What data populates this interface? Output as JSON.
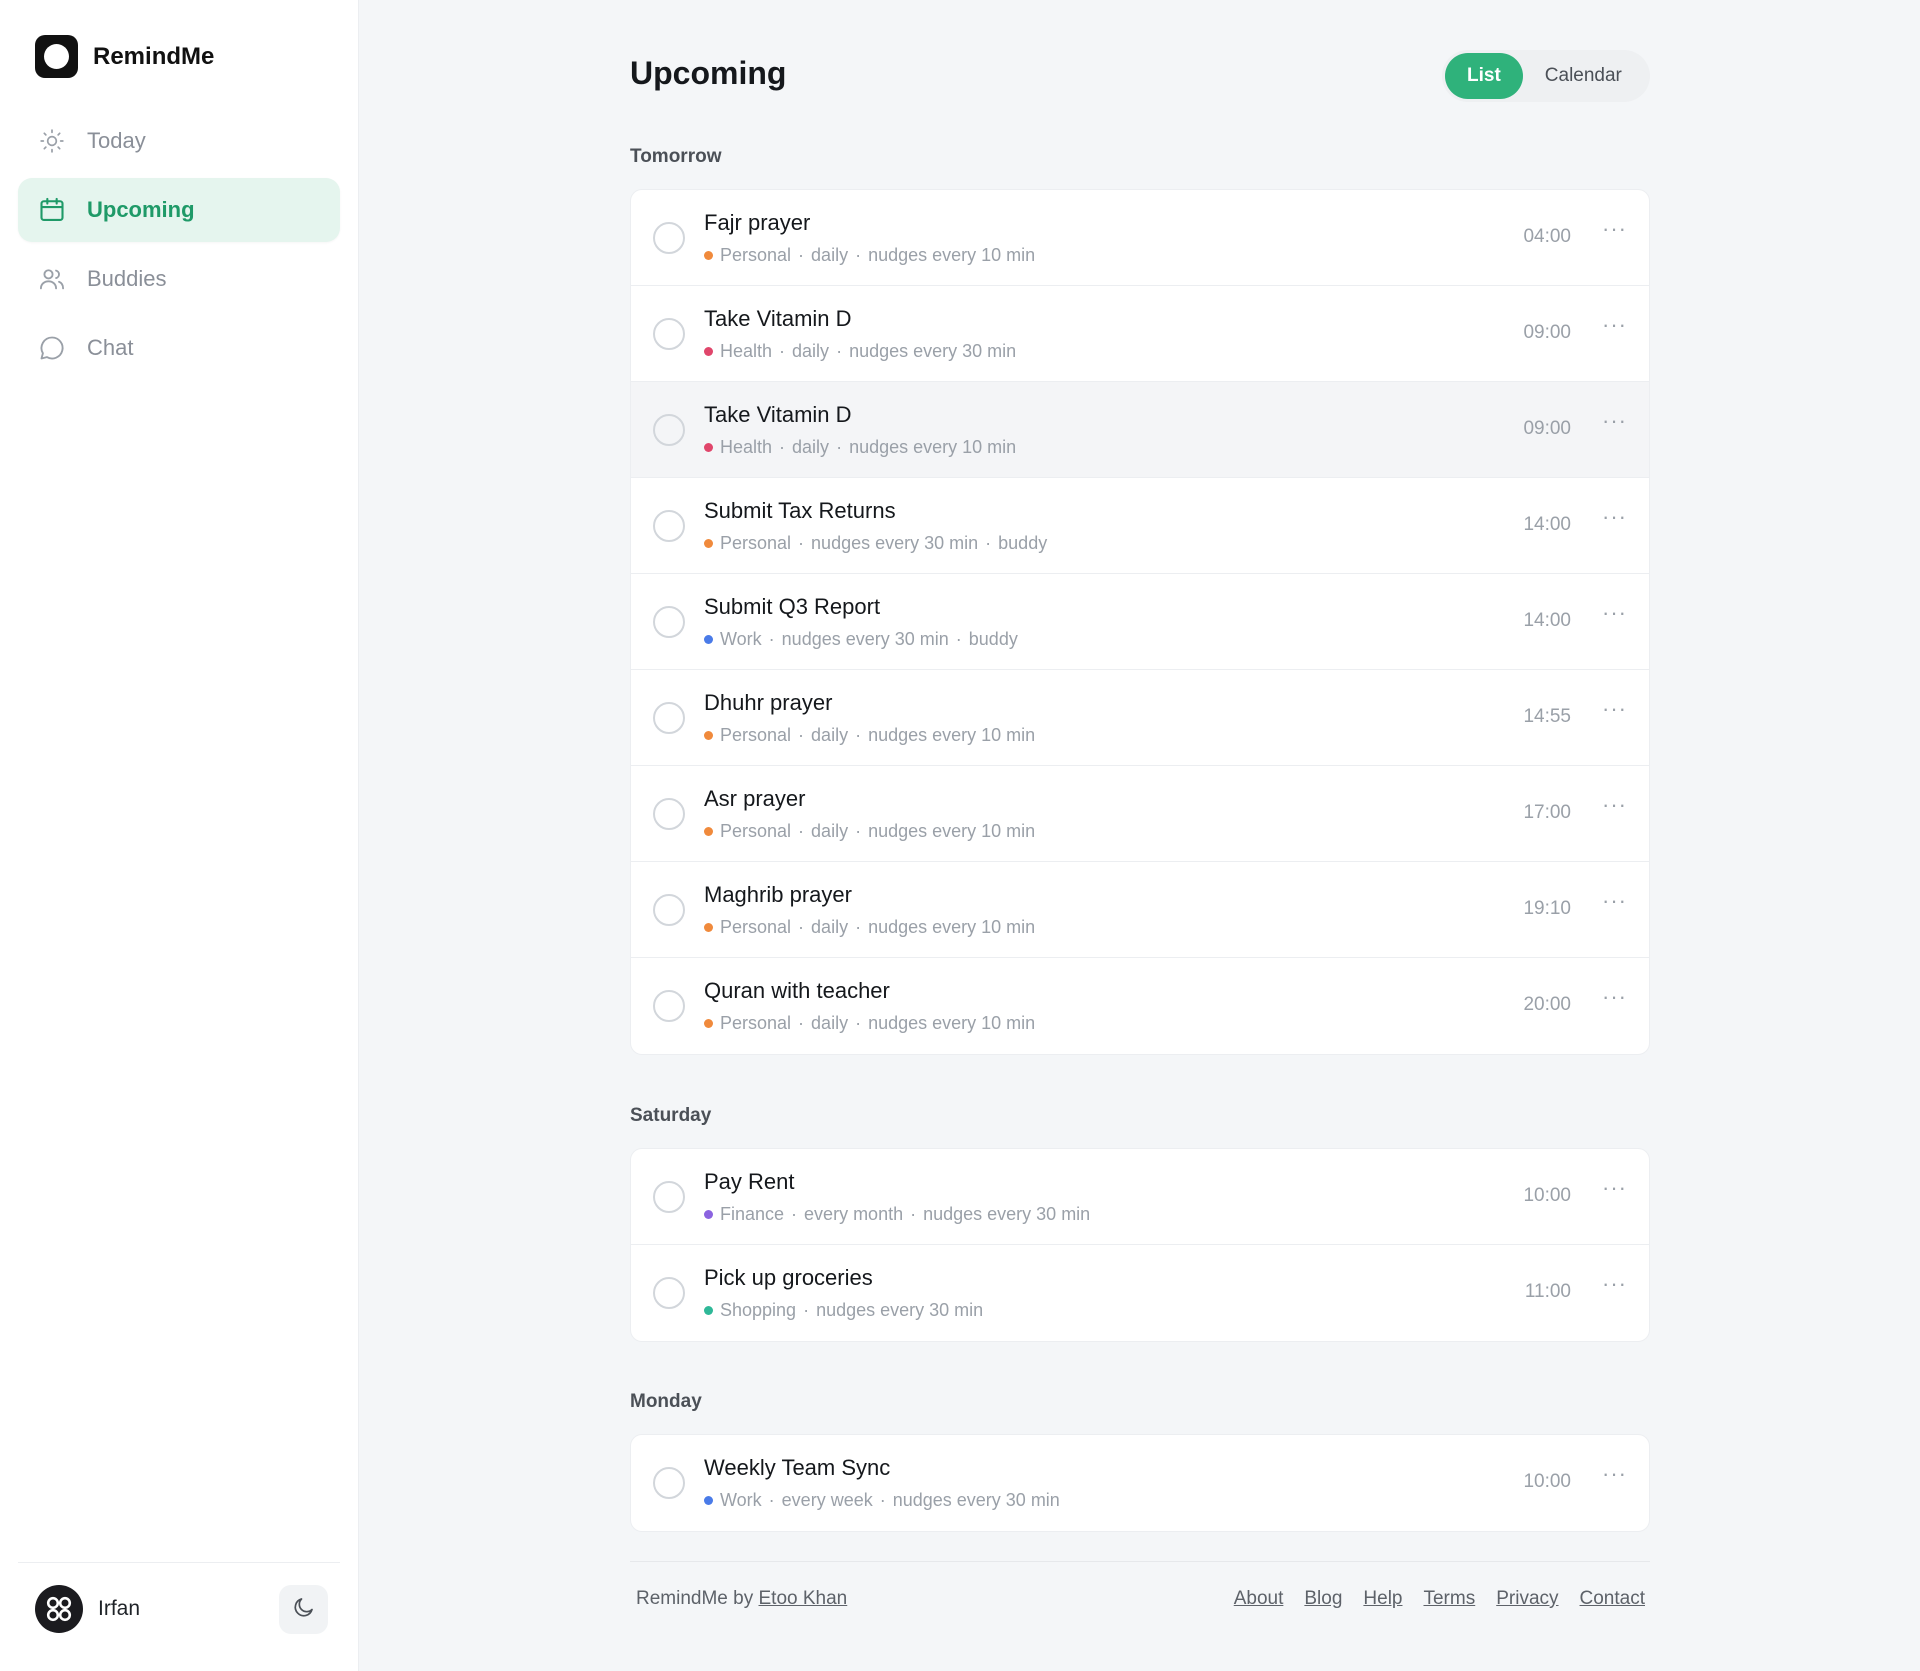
{
  "app": {
    "name": "RemindMe"
  },
  "sidebar": {
    "items": [
      {
        "label": "Today",
        "icon": "sun-icon",
        "active": false
      },
      {
        "label": "Upcoming",
        "icon": "calendar-icon",
        "active": true
      },
      {
        "label": "Buddies",
        "icon": "users-icon",
        "active": false
      },
      {
        "label": "Chat",
        "icon": "chat-bubble-icon",
        "active": false
      }
    ],
    "user": {
      "name": "Irfan"
    }
  },
  "header": {
    "title": "Upcoming",
    "view_toggle": {
      "list": "List",
      "calendar": "Calendar",
      "selected": "List"
    }
  },
  "category_colors": {
    "Personal": "#f08a3c",
    "Health": "#e0466b",
    "Work": "#4a7be8",
    "Finance": "#8b63e0",
    "Shopping": "#2fb898"
  },
  "sections": [
    {
      "title": "Tomorrow",
      "items": [
        {
          "title": "Fajr prayer",
          "category": "Personal",
          "details": [
            "daily",
            "nudges every 10 min"
          ],
          "time": "04:00"
        },
        {
          "title": "Take Vitamin D",
          "category": "Health",
          "details": [
            "daily",
            "nudges every 30 min"
          ],
          "time": "09:00"
        },
        {
          "title": "Take Vitamin D",
          "category": "Health",
          "details": [
            "daily",
            "nudges every 10 min"
          ],
          "time": "09:00"
        },
        {
          "title": "Submit Tax Returns",
          "category": "Personal",
          "details": [
            "nudges every 30 min",
            "buddy"
          ],
          "time": "14:00"
        },
        {
          "title": "Submit Q3 Report",
          "category": "Work",
          "details": [
            "nudges every 30 min",
            "buddy"
          ],
          "time": "14:00"
        },
        {
          "title": "Dhuhr prayer",
          "category": "Personal",
          "details": [
            "daily",
            "nudges every 10 min"
          ],
          "time": "14:55"
        },
        {
          "title": "Asr prayer",
          "category": "Personal",
          "details": [
            "daily",
            "nudges every 10 min"
          ],
          "time": "17:00"
        },
        {
          "title": "Maghrib prayer",
          "category": "Personal",
          "details": [
            "daily",
            "nudges every 10 min"
          ],
          "time": "19:10"
        },
        {
          "title": "Quran with teacher",
          "category": "Personal",
          "details": [
            "daily",
            "nudges every 10 min"
          ],
          "time": "20:00"
        }
      ]
    },
    {
      "title": "Saturday",
      "items": [
        {
          "title": "Pay Rent",
          "category": "Finance",
          "details": [
            "every month",
            "nudges every 30 min"
          ],
          "time": "10:00"
        },
        {
          "title": "Pick up groceries",
          "category": "Shopping",
          "details": [
            "nudges every 30 min"
          ],
          "time": "11:00"
        }
      ]
    },
    {
      "title": "Monday",
      "items": [
        {
          "title": "Weekly Team Sync",
          "category": "Work",
          "details": [
            "every week",
            "nudges every 30 min"
          ],
          "time": "10:00"
        }
      ]
    }
  ],
  "more_glyph": "···",
  "meta_separator": "·",
  "footer": {
    "prefix": "RemindMe by",
    "author": "Etoo Khan",
    "links": [
      "About",
      "Blog",
      "Help",
      "Terms",
      "Privacy",
      "Contact"
    ]
  }
}
